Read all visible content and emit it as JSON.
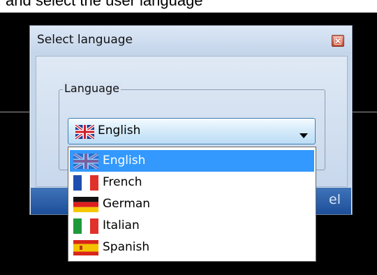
{
  "background_caption": "and select the user language",
  "dialog": {
    "title": "Select language",
    "group_label": "Language",
    "cancel_fragment": "el"
  },
  "combo": {
    "selected": "English",
    "selected_flag": "uk-flag-icon"
  },
  "dropdown": {
    "items": [
      {
        "label": "English",
        "flag": "uk-flag-icon",
        "selected": true
      },
      {
        "label": "French",
        "flag": "france-flag-icon",
        "selected": false
      },
      {
        "label": "German",
        "flag": "germany-flag-icon",
        "selected": false
      },
      {
        "label": "Italian",
        "flag": "italy-flag-icon",
        "selected": false
      },
      {
        "label": "Spanish",
        "flag": "spain-flag-icon",
        "selected": false
      }
    ]
  },
  "colors": {
    "selection_highlight": "#3399ff",
    "bottom_bar": "#1d4f99",
    "dialog_body": "#c6d6ea"
  }
}
